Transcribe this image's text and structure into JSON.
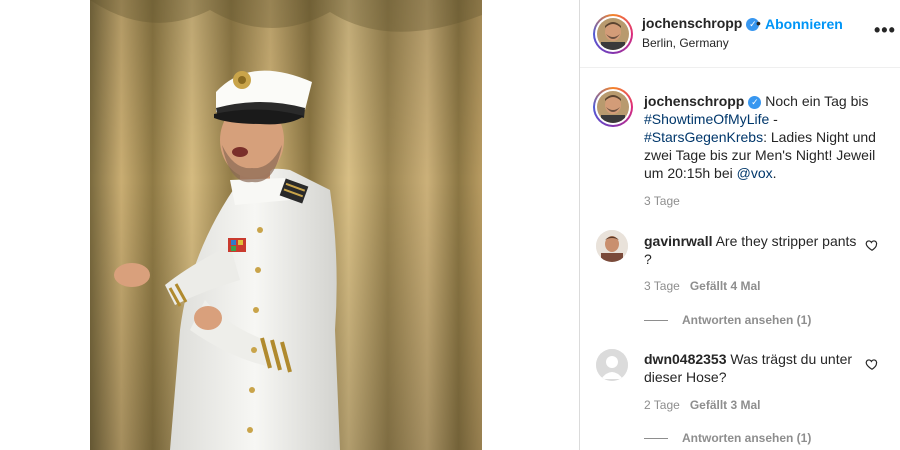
{
  "header": {
    "username": "jochenschropp",
    "dot": "•",
    "follow_label": "Abonnieren",
    "location": "Berlin, Germany",
    "more_icon": "more-horizontal-icon",
    "more_glyph": "•••"
  },
  "caption": {
    "username": "jochenschropp",
    "text_1": " Noch ein Tag bis ",
    "hashtag_1": "#ShowtimeOfMyLife",
    "text_2": " - ",
    "hashtag_2": "#StarsGegenKrebs",
    "text_3": ": Ladies Night und zwei Tage bis zur Men's Night! Jeweil um 20:15h bei ",
    "mention": "@vox",
    "text_4": ".",
    "time": "3 Tage"
  },
  "comments": [
    {
      "username": "gavinrwall",
      "text": " Are they stripper pants ?",
      "time": "3 Tage",
      "likes": "Gefällt 4 Mal",
      "replies": "Antworten ansehen (1)"
    },
    {
      "username": "dwn0482353",
      "text": " Was trägst du unter dieser Hose?",
      "time": "2 Tage",
      "likes": "Gefällt 3 Mal",
      "replies": "Antworten ansehen (1)"
    }
  ],
  "colors": {
    "accent": "#0095f6",
    "verified": "#3897f0",
    "muted": "#8e8e8e",
    "link": "#00376b",
    "curtain": "#b8975a"
  }
}
